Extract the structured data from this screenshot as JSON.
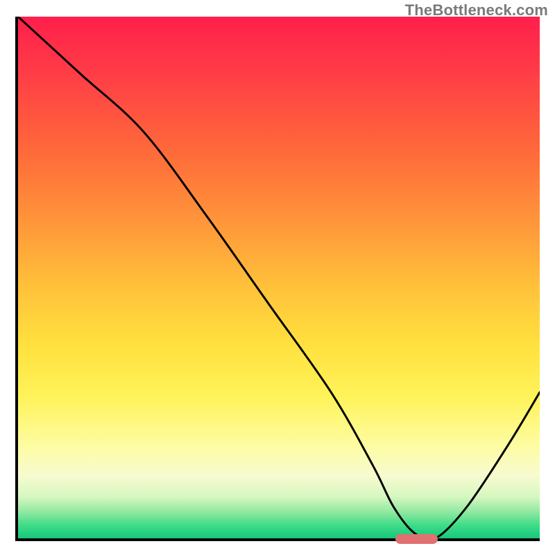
{
  "watermark": "TheBottleneck.com",
  "chart_data": {
    "type": "line",
    "title": "",
    "xlabel": "",
    "ylabel": "",
    "xlim": [
      0,
      100
    ],
    "ylim": [
      0,
      100
    ],
    "grid": false,
    "series": [
      {
        "name": "curve",
        "x": [
          0,
          12,
          24,
          36,
          48,
          60,
          68,
          72,
          76,
          80,
          86,
          94,
          100
        ],
        "y": [
          100,
          89,
          78,
          62,
          45,
          28,
          14,
          6,
          1,
          0,
          6,
          18,
          28
        ]
      }
    ],
    "marker": {
      "x_start": 72,
      "x_end": 80,
      "y": 0,
      "color": "#e17070"
    },
    "background_gradient": {
      "direction": "vertical",
      "stops": [
        {
          "pos": 0.0,
          "color": "#ff1f4b"
        },
        {
          "pos": 0.26,
          "color": "#ff6a3a"
        },
        {
          "pos": 0.52,
          "color": "#ffc23a"
        },
        {
          "pos": 0.73,
          "color": "#fff35a"
        },
        {
          "pos": 0.88,
          "color": "#f7fbd0"
        },
        {
          "pos": 0.95,
          "color": "#8ee8a0"
        },
        {
          "pos": 1.0,
          "color": "#18c77a"
        }
      ]
    }
  }
}
